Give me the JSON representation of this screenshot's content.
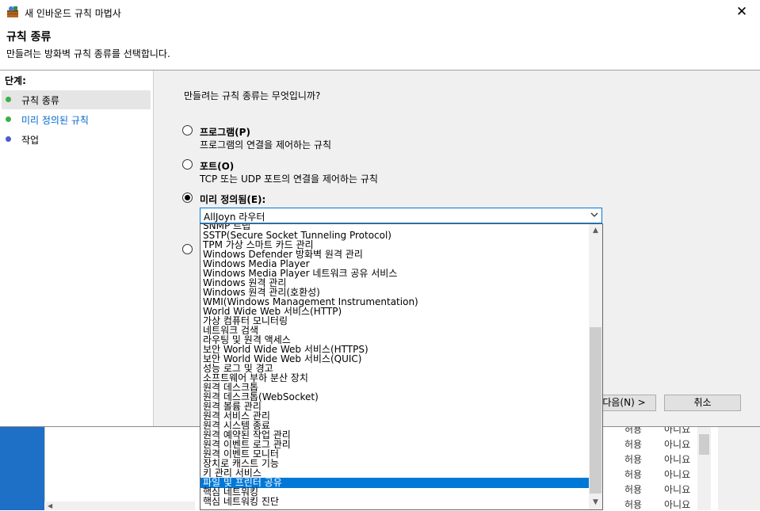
{
  "window": {
    "title": "새 인바운드 규칙 마법사",
    "close_glyph": "✕"
  },
  "header": {
    "title": "규칙 종류",
    "subtitle": "만들려는 방화벽 규칙 종류를 선택합니다."
  },
  "steps": {
    "label": "단계:",
    "items": [
      {
        "label": "규칙 종류",
        "dot_color": "#3cb043",
        "text_color": "#000000"
      },
      {
        "label": "미리 정의된 규칙",
        "dot_color": "#3cb043",
        "text_color": "#0066cc"
      },
      {
        "label": "작업",
        "dot_color": "#4a5bd4",
        "text_color": "#000000"
      }
    ]
  },
  "main": {
    "question": "만들려는 규칙 종류는 무엇입니까?",
    "options": [
      {
        "title": "프로그램(P)",
        "desc": "프로그램의 연결을 제어하는 규칙",
        "checked": false
      },
      {
        "title": "포트(O)",
        "desc": "TCP 또는 UDP 포트의 연결을 제어하는 규칙",
        "checked": false
      },
      {
        "title": "미리 정의됨(E):",
        "desc": "",
        "checked": true
      }
    ],
    "combo_value": "AllJoyn 라우터"
  },
  "dropdown": {
    "items": [
      "SNMP 트랩",
      "SSTP(Secure Socket Tunneling Protocol)",
      "TPM 가상 스마트 카드 관리",
      "Windows Defender 방화벽 원격 관리",
      "Windows Media Player",
      "Windows Media Player 네트워크 공유 서비스",
      "Windows 원격 관리",
      "Windows 원격 관리(호환성)",
      "WMI(Windows Management Instrumentation)",
      "World Wide Web 서비스(HTTP)",
      "가상 컴퓨터 모니터링",
      "네트워크 검색",
      "라우팅 및 원격 액세스",
      "보안 World Wide Web 서비스(HTTPS)",
      "보안 World Wide Web 서비스(QUIC)",
      "성능 로그 및 경고",
      "소프트웨어 부하 분산 장치",
      "원격 데스크톱",
      "원격 데스크톱(WebSocket)",
      "원격 볼륨 관리",
      "원격 서비스 관리",
      "원격 시스템 종료",
      "원격 예약된 작업 관리",
      "원격 이벤트 로그 관리",
      "원격 이벤트 모니터",
      "장치로 캐스트 기능",
      "키 관리 서비스",
      "파일 및 프린터 공유",
      "핵심 네트워킹",
      "핵심 네트워킹 진단"
    ],
    "selected_index": 27
  },
  "buttons": {
    "next": "다음(N) >",
    "cancel": "취소"
  },
  "background_rows": [
    {
      "c1": "허용",
      "c2": "아니요"
    },
    {
      "c1": "허용",
      "c2": "아니요"
    },
    {
      "c1": "허용",
      "c2": "아니요"
    },
    {
      "c1": "허용",
      "c2": "아니요"
    },
    {
      "c1": "허용",
      "c2": "아니요"
    },
    {
      "c1": "허용",
      "c2": "아니요"
    }
  ]
}
